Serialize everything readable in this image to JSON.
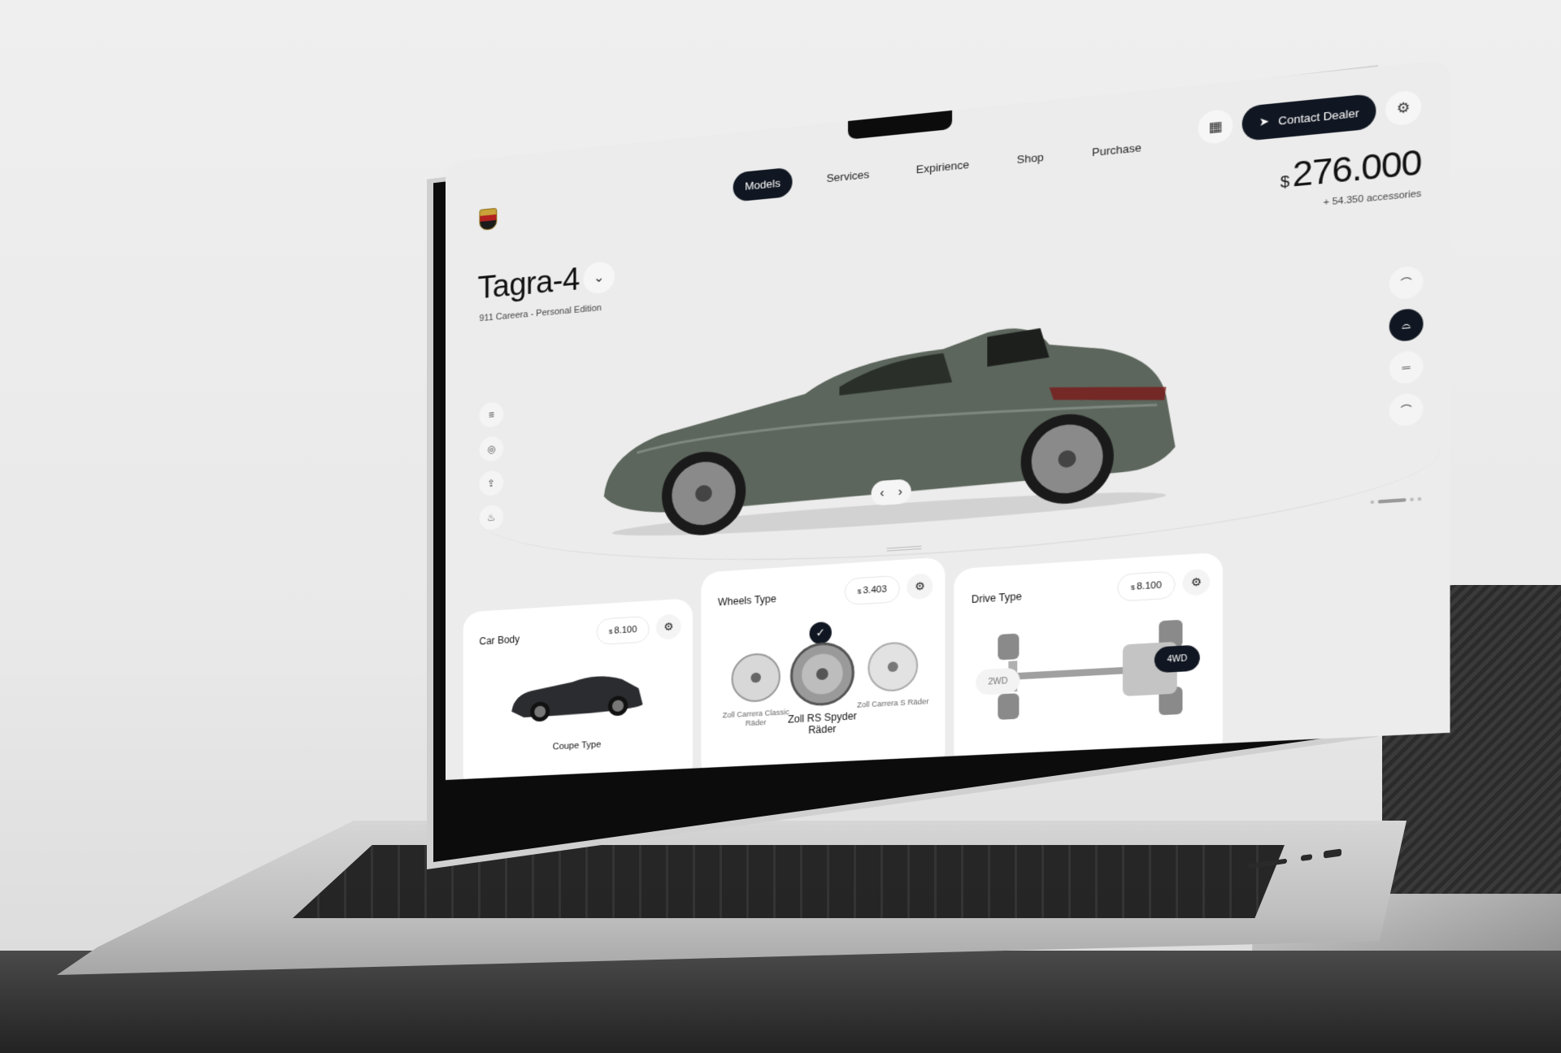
{
  "nav": {
    "items": [
      {
        "label": "Models",
        "active": true
      },
      {
        "label": "Services",
        "active": false
      },
      {
        "label": "Expirience",
        "active": false
      },
      {
        "label": "Shop",
        "active": false
      },
      {
        "label": "Purchase",
        "active": false
      }
    ]
  },
  "header": {
    "contact_label": "Contact Dealer",
    "grid_icon": "grid-icon",
    "settings_icon": "gear-icon"
  },
  "price": {
    "currency": "$",
    "amount": "276.000",
    "accessories": "+ 54.350 accessories"
  },
  "model": {
    "title": "Tagra-4",
    "subtitle": "911 Careera - Personal Edition"
  },
  "cards": {
    "car_body": {
      "title": "Car Body",
      "currency": "$",
      "price": "8.100",
      "selected_label": "Coupe Type"
    },
    "wheels": {
      "title": "Wheels Type",
      "currency": "$",
      "price": "3.403",
      "options": [
        {
          "label": "Zoll Carrera Classic Räder",
          "selected": false
        },
        {
          "label": "Zoll RS Spyder Räder",
          "selected": true
        },
        {
          "label": "Zoll Carrera S Räder",
          "selected": false
        }
      ]
    },
    "drive": {
      "title": "Drive Type",
      "currency": "$",
      "price": "8.100",
      "options": [
        {
          "label": "2WD",
          "selected": false
        },
        {
          "label": "4WD",
          "selected": true
        }
      ]
    }
  },
  "colors": {
    "accent_dark": "#111722",
    "car_paint": "#5c665c",
    "screen_bg": "#ececec"
  }
}
